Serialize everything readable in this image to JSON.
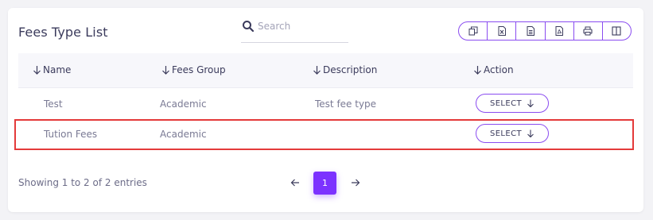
{
  "header": {
    "title": "Fees Type List",
    "search_placeholder": "Search"
  },
  "toolbar": {
    "buttons": [
      {
        "icon": "copy-icon"
      },
      {
        "icon": "excel-icon"
      },
      {
        "icon": "csv-icon"
      },
      {
        "icon": "pdf-icon"
      },
      {
        "icon": "print-icon"
      },
      {
        "icon": "columns-icon"
      }
    ]
  },
  "table": {
    "columns": [
      "Name",
      "Fees Group",
      "Description",
      "Action"
    ],
    "rows": [
      {
        "name": "Test",
        "group": "Academic",
        "description": "Test fee type",
        "action": "SELECT"
      },
      {
        "name": "Tution Fees",
        "group": "Academic",
        "description": "",
        "action": "SELECT"
      }
    ]
  },
  "footer": {
    "info": "Showing 1 to 2 of 2 entries",
    "current_page": "1"
  },
  "colors": {
    "accent": "#7c32ff",
    "border_accent": "#8a4cf0",
    "highlight": "#e43a3a"
  }
}
